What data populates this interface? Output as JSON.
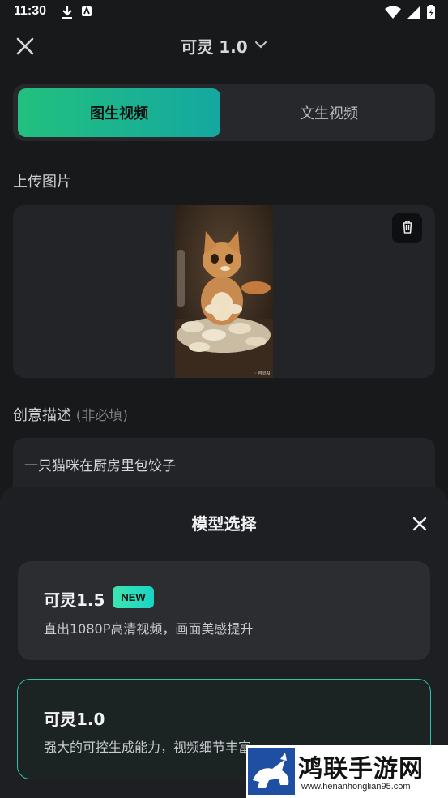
{
  "status_bar": {
    "time": "11:30"
  },
  "top_bar": {
    "title": "可灵 1.0"
  },
  "mode_tabs": [
    {
      "label": "图生视频",
      "active": true
    },
    {
      "label": "文生视频",
      "active": false
    }
  ],
  "upload": {
    "label": "上传图片"
  },
  "prompt": {
    "label": "创意描述",
    "hint": "(非必填)",
    "value": "一只猫咪在厨房里包饺子"
  },
  "model_sheet": {
    "title": "模型选择",
    "options": [
      {
        "name": "可灵1.5",
        "badge": "NEW",
        "desc": "直出1080P高清视频，画面美感提升",
        "selected": false
      },
      {
        "name": "可灵1.0",
        "badge": "",
        "desc": "强大的可控生成能力，视频细节丰富",
        "selected": true
      }
    ]
  },
  "watermark": {
    "main": "鸿联手游网",
    "sub": "www.henanhonglian95.com"
  },
  "colors": {
    "accent_start": "#22c07f",
    "accent_end": "#14a8a0",
    "selected_border": "#27c6a6",
    "background": "#18191b"
  }
}
